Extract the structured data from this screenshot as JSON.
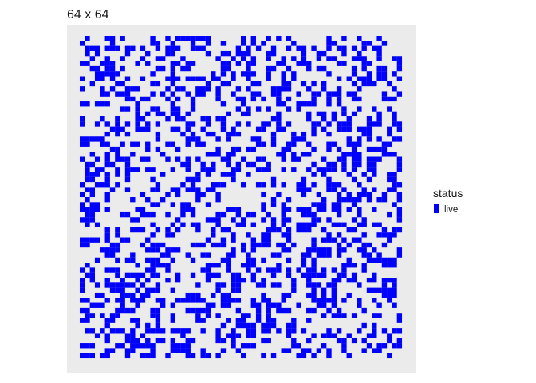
{
  "chart_data": {
    "type": "heatmap",
    "title": "64 x 64",
    "xlabel": "",
    "ylabel": "",
    "grid": false,
    "legend_position": "right",
    "legend": {
      "title": "status",
      "entries": [
        {
          "label": "live",
          "color": "#0000FF"
        }
      ]
    },
    "n_rows": 64,
    "n_cols": 64,
    "fill_color": "#0000FF",
    "panel_color": "#EBEBEB",
    "seed": 4242,
    "density": 0.36
  }
}
